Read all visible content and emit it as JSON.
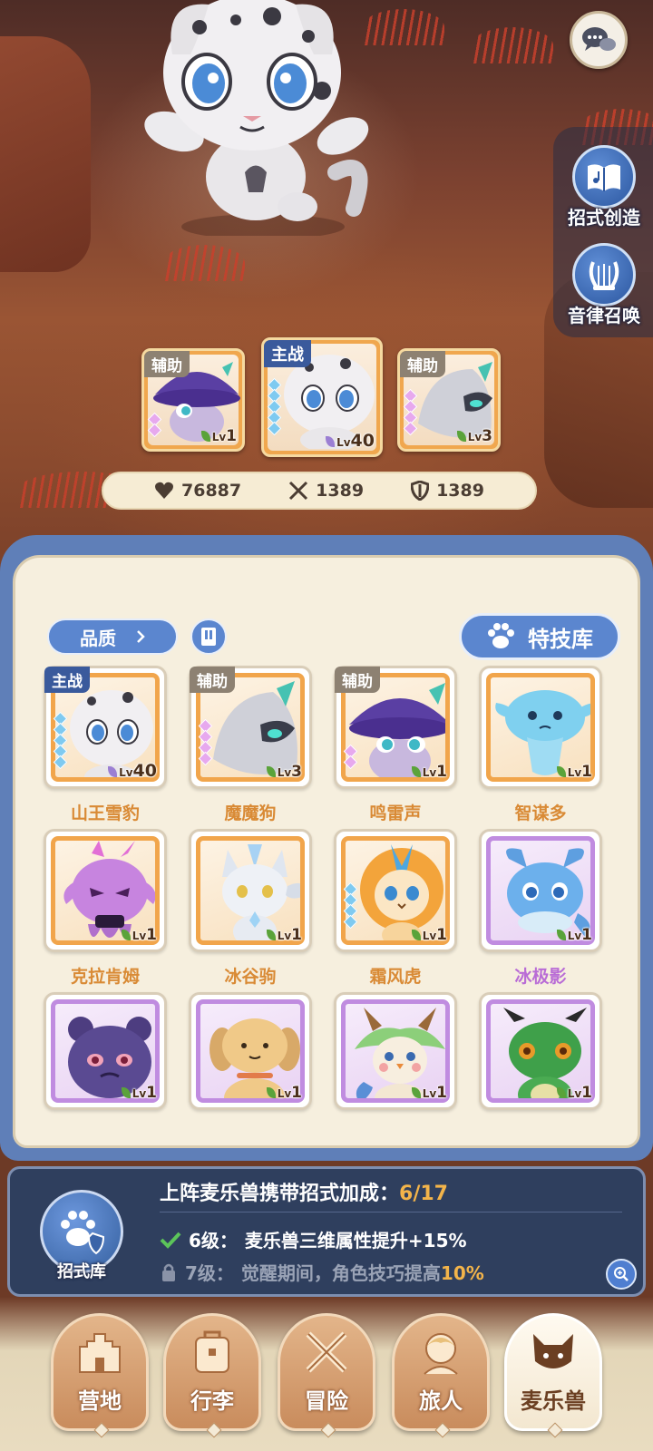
{
  "scene": {
    "chat_icon": "chat-bubbles-icon",
    "side_buttons": [
      {
        "label": "招式创造",
        "icon": "book-music-icon"
      },
      {
        "label": "音律召唤",
        "icon": "lyre-icon"
      }
    ]
  },
  "team": [
    {
      "role": "辅助",
      "level": "1",
      "level_prefix": "Lv",
      "stars": 2
    },
    {
      "role": "主战",
      "level": "40",
      "level_prefix": "Lv",
      "stars": 5
    },
    {
      "role": "辅助",
      "level": "3",
      "level_prefix": "Lv",
      "stars": 4
    }
  ],
  "stats": {
    "hp": "76887",
    "attack": "1389",
    "defense": "1389"
  },
  "filters": {
    "quality_label": "品质",
    "skill_library_label": "特技库"
  },
  "pets": [
    {
      "name": "山王雪豹",
      "level": "40",
      "role": "主战",
      "rarity": "orange"
    },
    {
      "name": "魔魔狗",
      "level": "3",
      "role": "辅助",
      "rarity": "orange"
    },
    {
      "name": "鸣雷声",
      "level": "1",
      "role": "辅助",
      "rarity": "orange"
    },
    {
      "name": "智谋多",
      "level": "1",
      "role": "",
      "rarity": "orange"
    },
    {
      "name": "克拉肯姆",
      "level": "1",
      "role": "",
      "rarity": "orange"
    },
    {
      "name": "冰谷驹",
      "level": "1",
      "role": "",
      "rarity": "orange"
    },
    {
      "name": "霜风虎",
      "level": "1",
      "role": "",
      "rarity": "orange"
    },
    {
      "name": "冰极影",
      "level": "1",
      "role": "",
      "rarity": "purple"
    },
    {
      "name": "",
      "level": "1",
      "role": "",
      "rarity": "purple"
    },
    {
      "name": "",
      "level": "1",
      "role": "",
      "rarity": "purple"
    },
    {
      "name": "",
      "level": "1",
      "role": "",
      "rarity": "purple"
    },
    {
      "name": "",
      "level": "1",
      "role": "",
      "rarity": "purple"
    }
  ],
  "bonus": {
    "title": "上阵麦乐兽携带招式加成：",
    "count": "6/17",
    "move_library_label": "招式库",
    "line1_level": "6级：",
    "line1_text": "麦乐兽三维属性提升+15%",
    "line2_level": "7级：",
    "line2_text": "觉醒期间，角色技巧提高",
    "line2_value": "10%"
  },
  "nav": [
    {
      "label": "营地",
      "icon": "castle-icon"
    },
    {
      "label": "行李",
      "icon": "backpack-icon"
    },
    {
      "label": "冒险",
      "icon": "crossed-swords-icon"
    },
    {
      "label": "旅人",
      "icon": "traveler-icon"
    },
    {
      "label": "麦乐兽",
      "icon": "cat-face-icon"
    }
  ],
  "colors": {
    "accent_blue": "#5b86cf",
    "rarity_orange": "#f1a54b",
    "rarity_purple": "#c08ce0",
    "highlight": "#f3b44a"
  }
}
